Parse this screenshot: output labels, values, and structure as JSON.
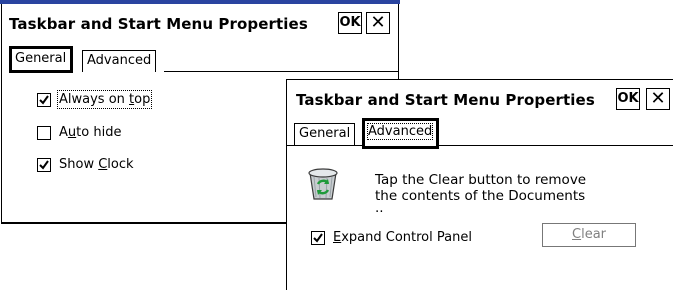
{
  "window_general": {
    "title": "Taskbar and Start Menu Properties",
    "ok_label": "OK",
    "close_label": "✕",
    "tabs": [
      {
        "label": "General",
        "active": true
      },
      {
        "label": "Advanced",
        "active": false
      }
    ],
    "options": [
      {
        "pre": "Always on ",
        "mnemonic": "t",
        "post": "op",
        "checked": true
      },
      {
        "pre": "A",
        "mnemonic": "u",
        "post": "to hide",
        "checked": false
      },
      {
        "pre": "Show ",
        "mnemonic": "C",
        "post": "lock",
        "checked": true
      }
    ]
  },
  "window_advanced": {
    "title": "Taskbar and Start Menu Properties",
    "ok_label": "OK",
    "close_label": "✕",
    "tabs": [
      {
        "label": "General",
        "active": false
      },
      {
        "label": "Advanced",
        "active": true
      }
    ],
    "recycle_icon": "recycle-bin-icon",
    "description_line1": "Tap the Clear button to remove",
    "description_line2": "the contents of the Documents",
    "description_line3": "..",
    "expand_option": {
      "pre": "",
      "mnemonic": "E",
      "post": "xpand Control Panel",
      "checked": true
    },
    "clear_button": {
      "mnemonic": "C",
      "post": "lear",
      "enabled": false
    }
  }
}
